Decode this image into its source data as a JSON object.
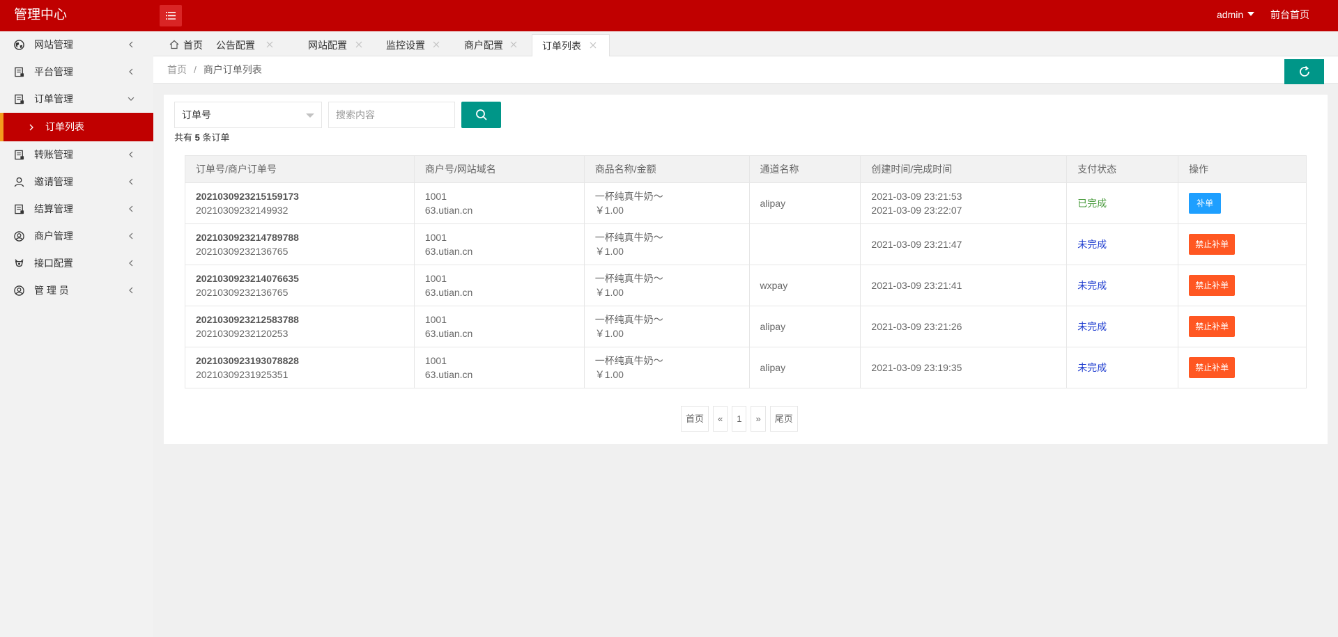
{
  "header": {
    "title": "管理中心",
    "user": "admin",
    "front_link": "前台首页"
  },
  "sidebar": {
    "items": [
      {
        "label": "网站管理",
        "icon": "globe-icon"
      },
      {
        "label": "平台管理",
        "icon": "clipboard-icon"
      },
      {
        "label": "订单管理",
        "icon": "clipboard-icon",
        "expanded": true
      },
      {
        "label": "转账管理",
        "icon": "clipboard-icon"
      },
      {
        "label": "邀请管理",
        "icon": "user-icon"
      },
      {
        "label": "结算管理",
        "icon": "clipboard-icon"
      },
      {
        "label": "商户管理",
        "icon": "user-circle-icon"
      },
      {
        "label": "接口配置",
        "icon": "plug-icon"
      },
      {
        "label": "管 理 员",
        "icon": "user-circle-icon"
      }
    ],
    "sub_item": "订单列表"
  },
  "tabs": [
    {
      "label": "首页"
    },
    {
      "label": "公告配置"
    },
    {
      "label": "网站配置"
    },
    {
      "label": "监控设置"
    },
    {
      "label": "商户配置"
    },
    {
      "label": "订单列表",
      "active": true
    }
  ],
  "breadcrumb": {
    "home": "首页",
    "separator": "/",
    "current": "商户订单列表"
  },
  "filter": {
    "select_value": "订单号",
    "search_placeholder": "搜索内容"
  },
  "summary": {
    "prefix": "共有",
    "count": "5",
    "suffix": "条订单"
  },
  "table": {
    "headers": [
      "订单号/商户订单号",
      "商户号/网站域名",
      "商品名称/金额",
      "通道名称",
      "创建时间/完成时间",
      "支付状态",
      "操作"
    ],
    "rows": [
      {
        "order_no": "2021030923215159173",
        "merchant_order_no": "20210309232149932",
        "merchant_id": "1001",
        "domain": "63.utian.cn",
        "product": "一杯纯真牛奶～",
        "amount": "￥1.00",
        "channel": "alipay",
        "created": "2021-03-09 23:21:53",
        "completed": "2021-03-09 23:22:07",
        "status": "已完成",
        "action": "补单"
      },
      {
        "order_no": "2021030923214789788",
        "merchant_order_no": "20210309232136765",
        "merchant_id": "1001",
        "domain": "63.utian.cn",
        "product": "一杯纯真牛奶～",
        "amount": "￥1.00",
        "channel": "",
        "created": "2021-03-09 23:21:47",
        "completed": "",
        "status": "未完成",
        "action": "禁止补单"
      },
      {
        "order_no": "2021030923214076635",
        "merchant_order_no": "20210309232136765",
        "merchant_id": "1001",
        "domain": "63.utian.cn",
        "product": "一杯纯真牛奶～",
        "amount": "￥1.00",
        "channel": "wxpay",
        "created": "2021-03-09 23:21:41",
        "completed": "",
        "status": "未完成",
        "action": "禁止补单"
      },
      {
        "order_no": "2021030923212583788",
        "merchant_order_no": "20210309232120253",
        "merchant_id": "1001",
        "domain": "63.utian.cn",
        "product": "一杯纯真牛奶～",
        "amount": "￥1.00",
        "channel": "alipay",
        "created": "2021-03-09 23:21:26",
        "completed": "",
        "status": "未完成",
        "action": "禁止补单"
      },
      {
        "order_no": "2021030923193078828",
        "merchant_order_no": "20210309231925351",
        "merchant_id": "1001",
        "domain": "63.utian.cn",
        "product": "一杯纯真牛奶～",
        "amount": "￥1.00",
        "channel": "alipay",
        "created": "2021-03-09 23:19:35",
        "completed": "",
        "status": "未完成",
        "action": "禁止补单"
      }
    ]
  },
  "pagination": {
    "first": "首页",
    "prev": "«",
    "page": "1",
    "next": "»",
    "last": "尾页"
  },
  "colors": {
    "brand_red": "#c00000",
    "accent_teal": "#009688",
    "blue_button": "#1e9fff",
    "orange_button": "#ff5722",
    "status_done": "#4a9b3d",
    "status_undone": "#1e3ccf"
  }
}
